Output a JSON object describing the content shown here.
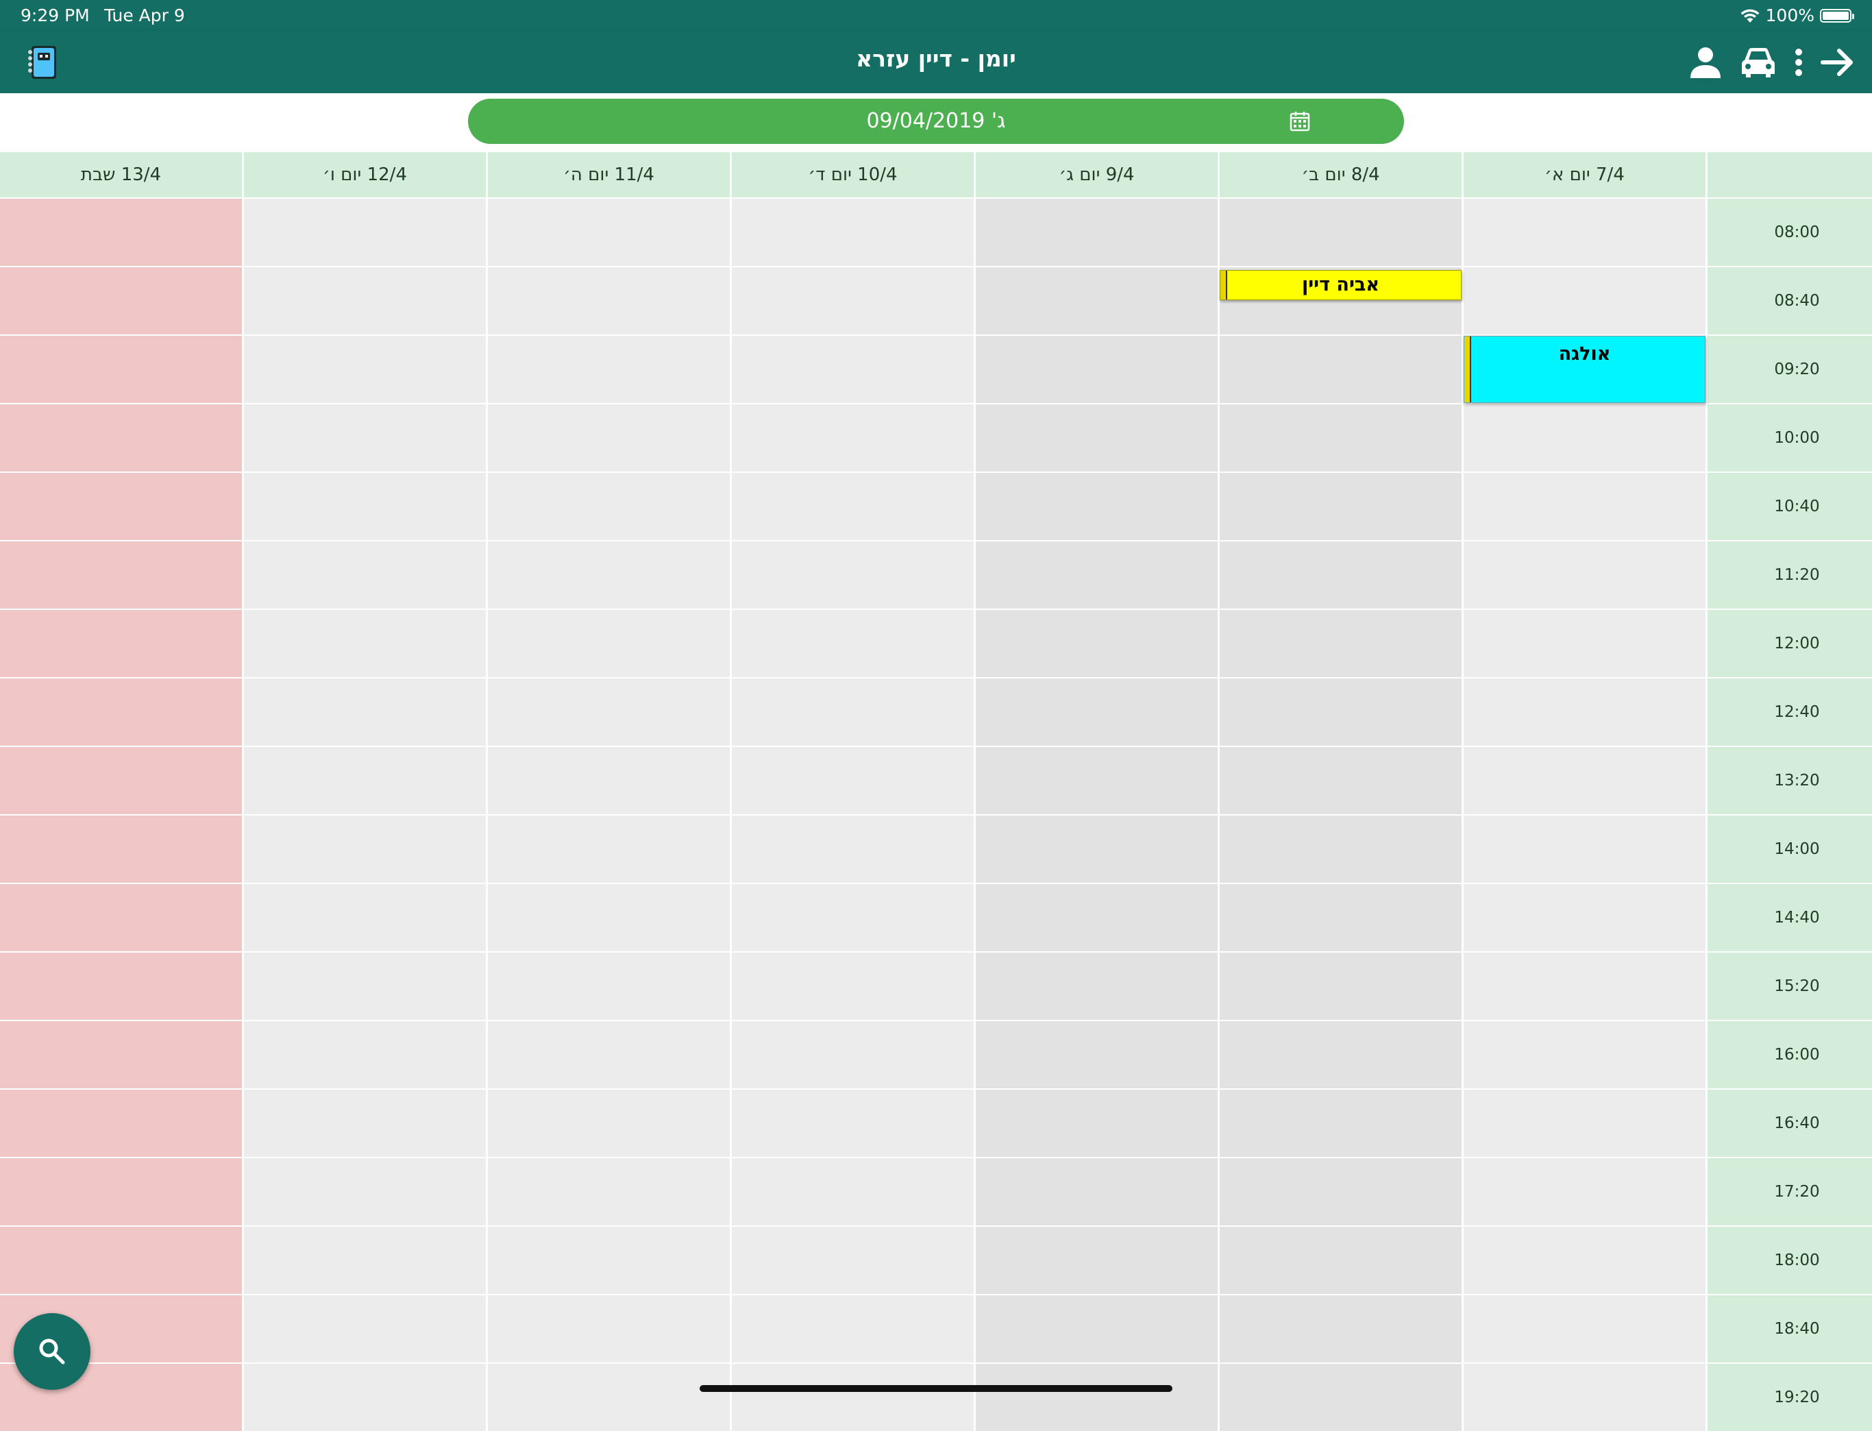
{
  "status_bar": {
    "time": "9:29 PM",
    "date": "Tue Apr 9",
    "battery": "100%"
  },
  "header": {
    "title": "יומן - דיין עזרא",
    "icons": [
      "notebook-icon",
      "person-icon",
      "car-icon",
      "more-vertical-icon",
      "arrow-right-icon"
    ]
  },
  "date_bar": {
    "text": "ג' 09/04/2019",
    "icon": "calendar-icon"
  },
  "days": [
    {
      "label": "13/4 שבת"
    },
    {
      "label": "12/4 יום ו׳"
    },
    {
      "label": "11/4 יום ה׳"
    },
    {
      "label": "10/4 יום ד׳"
    },
    {
      "label": "9/4 יום ג׳"
    },
    {
      "label": "8/4 יום ב׳"
    },
    {
      "label": "7/4 יום א׳"
    }
  ],
  "times": [
    "08:00",
    "08:40",
    "09:20",
    "10:00",
    "10:40",
    "11:20",
    "12:00",
    "12:40",
    "13:20",
    "14:00",
    "14:40",
    "15:20",
    "16:00",
    "16:40",
    "17:20",
    "18:00",
    "18:40",
    "19:20"
  ],
  "events": [
    {
      "name": "אביה דיין",
      "day_index": 5,
      "slot_index": 1,
      "color": "#ffff00"
    },
    {
      "name": "אולגה",
      "day_index": 6,
      "slot_index": 2,
      "color": "#00f5ff"
    }
  ],
  "colors": {
    "brand": "#146e64",
    "accent": "#4caf50",
    "header_bg": "#d4edda",
    "shabbat": "#f1c6c6"
  },
  "search_button": {
    "icon": "search-icon"
  }
}
